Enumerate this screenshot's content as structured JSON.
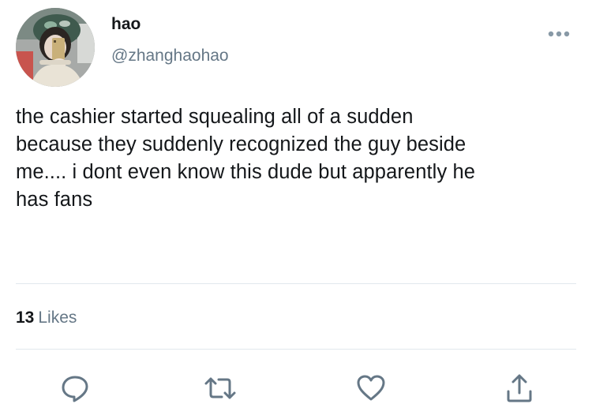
{
  "author": {
    "display_name": "hao",
    "handle": "@zhanghaohao"
  },
  "tweet": {
    "lines": [
      "the cashier started squealing all of a sudden",
      "because they suddenly recognized the guy beside",
      "me.... i dont even know this dude but apparently he",
      "has fans"
    ]
  },
  "stats": {
    "likes_count": "13",
    "likes_label": "Likes"
  },
  "actions": [
    {
      "icon": "reply-icon"
    },
    {
      "icon": "retweet-icon"
    },
    {
      "icon": "heart-icon"
    },
    {
      "icon": "share-icon"
    }
  ],
  "colors": {
    "text_primary": "#14171a",
    "text_secondary": "#657786",
    "divider": "#e1e8ed"
  }
}
